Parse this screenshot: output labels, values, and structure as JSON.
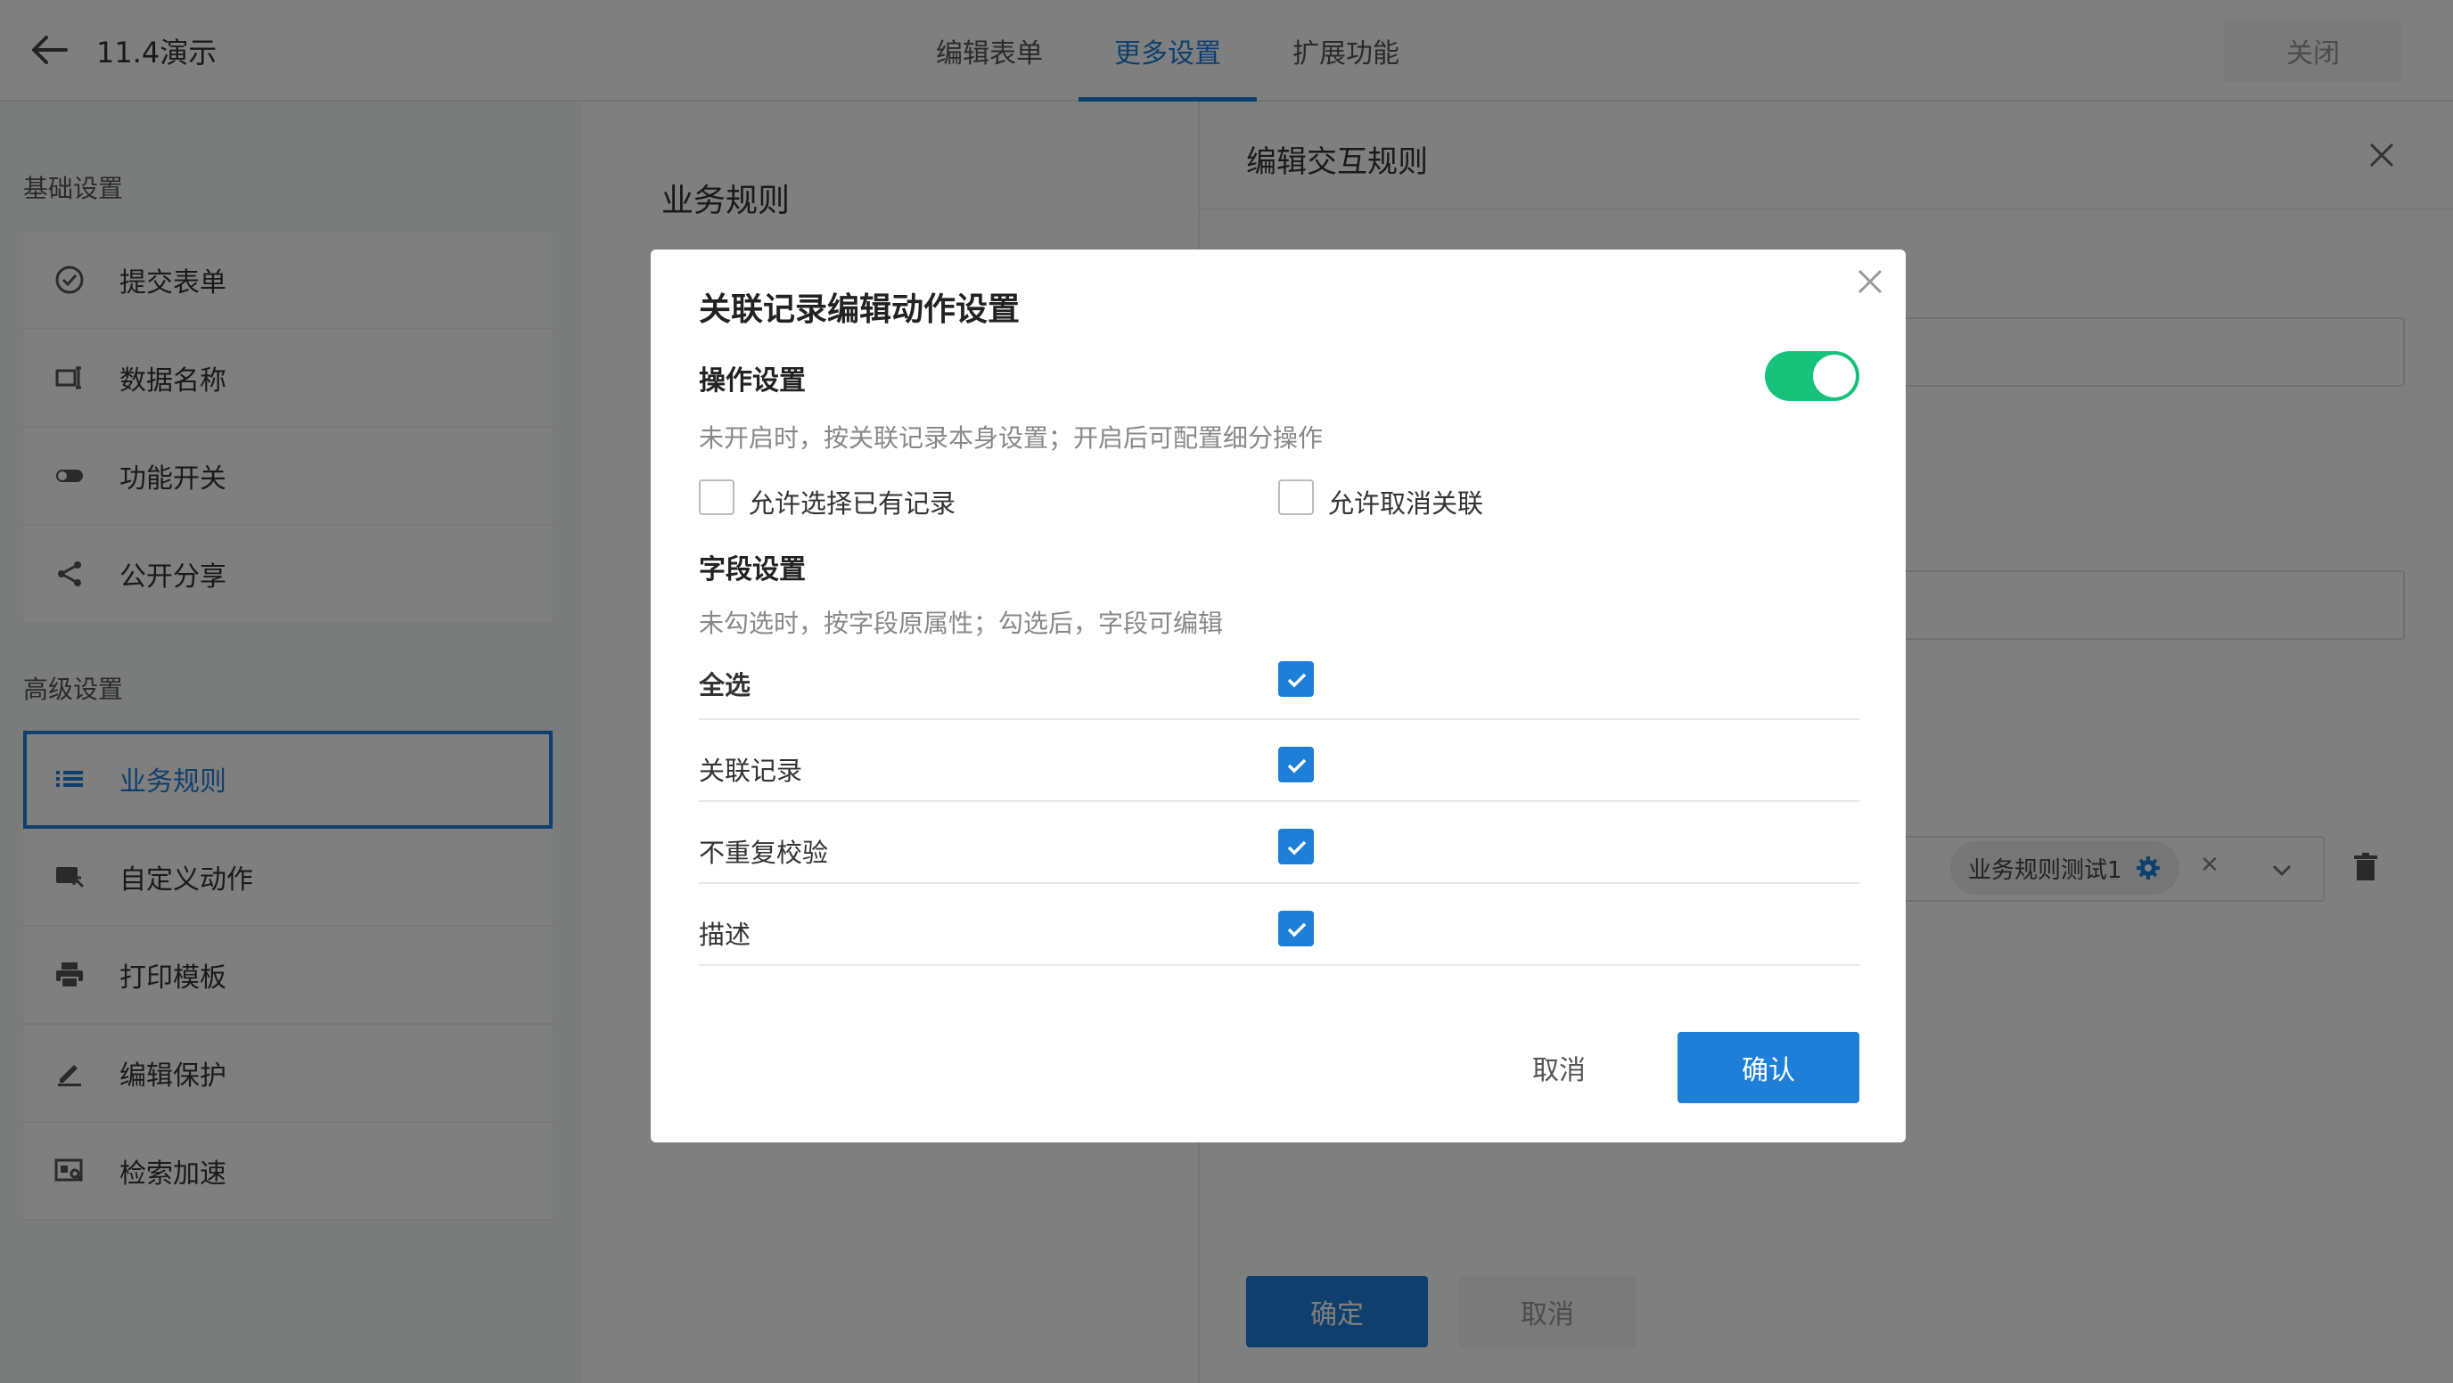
{
  "app": {
    "title": "11.4演示",
    "close_label": "关闭"
  },
  "tabs": [
    {
      "label": "编辑表单"
    },
    {
      "label": "更多设置"
    },
    {
      "label": "扩展功能"
    }
  ],
  "sidebar": {
    "basic_title": "基础设置",
    "basic_items": [
      {
        "label": "提交表单",
        "icon": "check-circle-icon"
      },
      {
        "label": "数据名称",
        "icon": "label-icon"
      },
      {
        "label": "功能开关",
        "icon": "toggle-icon"
      },
      {
        "label": "公开分享",
        "icon": "share-icon"
      }
    ],
    "advanced_title": "高级设置",
    "advanced_items": [
      {
        "label": "业务规则",
        "icon": "list-icon"
      },
      {
        "label": "自定义动作",
        "icon": "action-icon"
      },
      {
        "label": "打印模板",
        "icon": "printer-icon"
      },
      {
        "label": "编辑保护",
        "icon": "pencil-icon"
      },
      {
        "label": "检索加速",
        "icon": "search-card-icon"
      }
    ]
  },
  "middle": {
    "title": "业务规则"
  },
  "drawer": {
    "title": "编辑交互规则",
    "rule_chip": "业务规则测试1",
    "ok_label": "确定",
    "cancel_label": "取消"
  },
  "modal": {
    "title": "关联记录编辑动作设置",
    "op_title": "操作设置",
    "op_enabled": true,
    "op_desc": "未开启时，按关联记录本身设置；开启后可配置细分操作",
    "opt_select_existing": "允许选择已有记录",
    "opt_cancel_link": "允许取消关联",
    "field_title": "字段设置",
    "field_desc": "未勾选时，按字段原属性；勾选后，字段可编辑",
    "select_all": "全选",
    "fields": [
      {
        "label": "关联记录",
        "checked": true
      },
      {
        "label": "不重复校验",
        "checked": true
      },
      {
        "label": "描述",
        "checked": true
      }
    ],
    "cancel_label": "取消",
    "confirm_label": "确认"
  },
  "colors": {
    "accent": "#1e7fd9",
    "toggle_on": "#16c27a"
  }
}
